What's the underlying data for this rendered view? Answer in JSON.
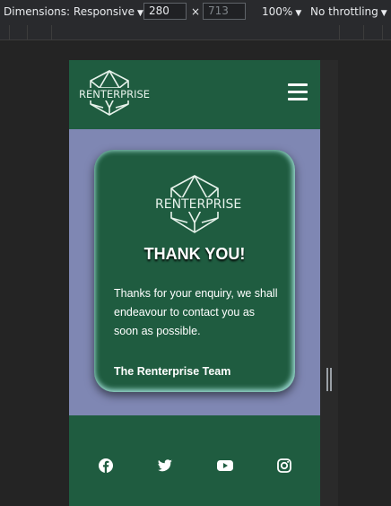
{
  "devtools": {
    "dimensions_label": "Dimensions: Responsive",
    "width_value": "280",
    "height_placeholder": "713",
    "times": "×",
    "zoom": "100%",
    "throttling": "No throttling",
    "caret": "▼"
  },
  "header": {
    "logo_text": "RENTERPRISE",
    "menu_icon": "hamburger-menu-icon"
  },
  "card": {
    "logo_text": "RENTERPRISE",
    "title": "THANK YOU!",
    "message": "Thanks for your enquiry, we shall endeavour to contact you as soon as possible.",
    "signature": "The Renterprise Team"
  },
  "footer": {
    "social_icons": [
      "facebook-icon",
      "twitter-icon",
      "youtube-icon",
      "instagram-icon"
    ]
  },
  "colors": {
    "brand_green": "#1f5c40",
    "page_background": "#7f87b3",
    "card_glow": "#9ad8d0"
  }
}
